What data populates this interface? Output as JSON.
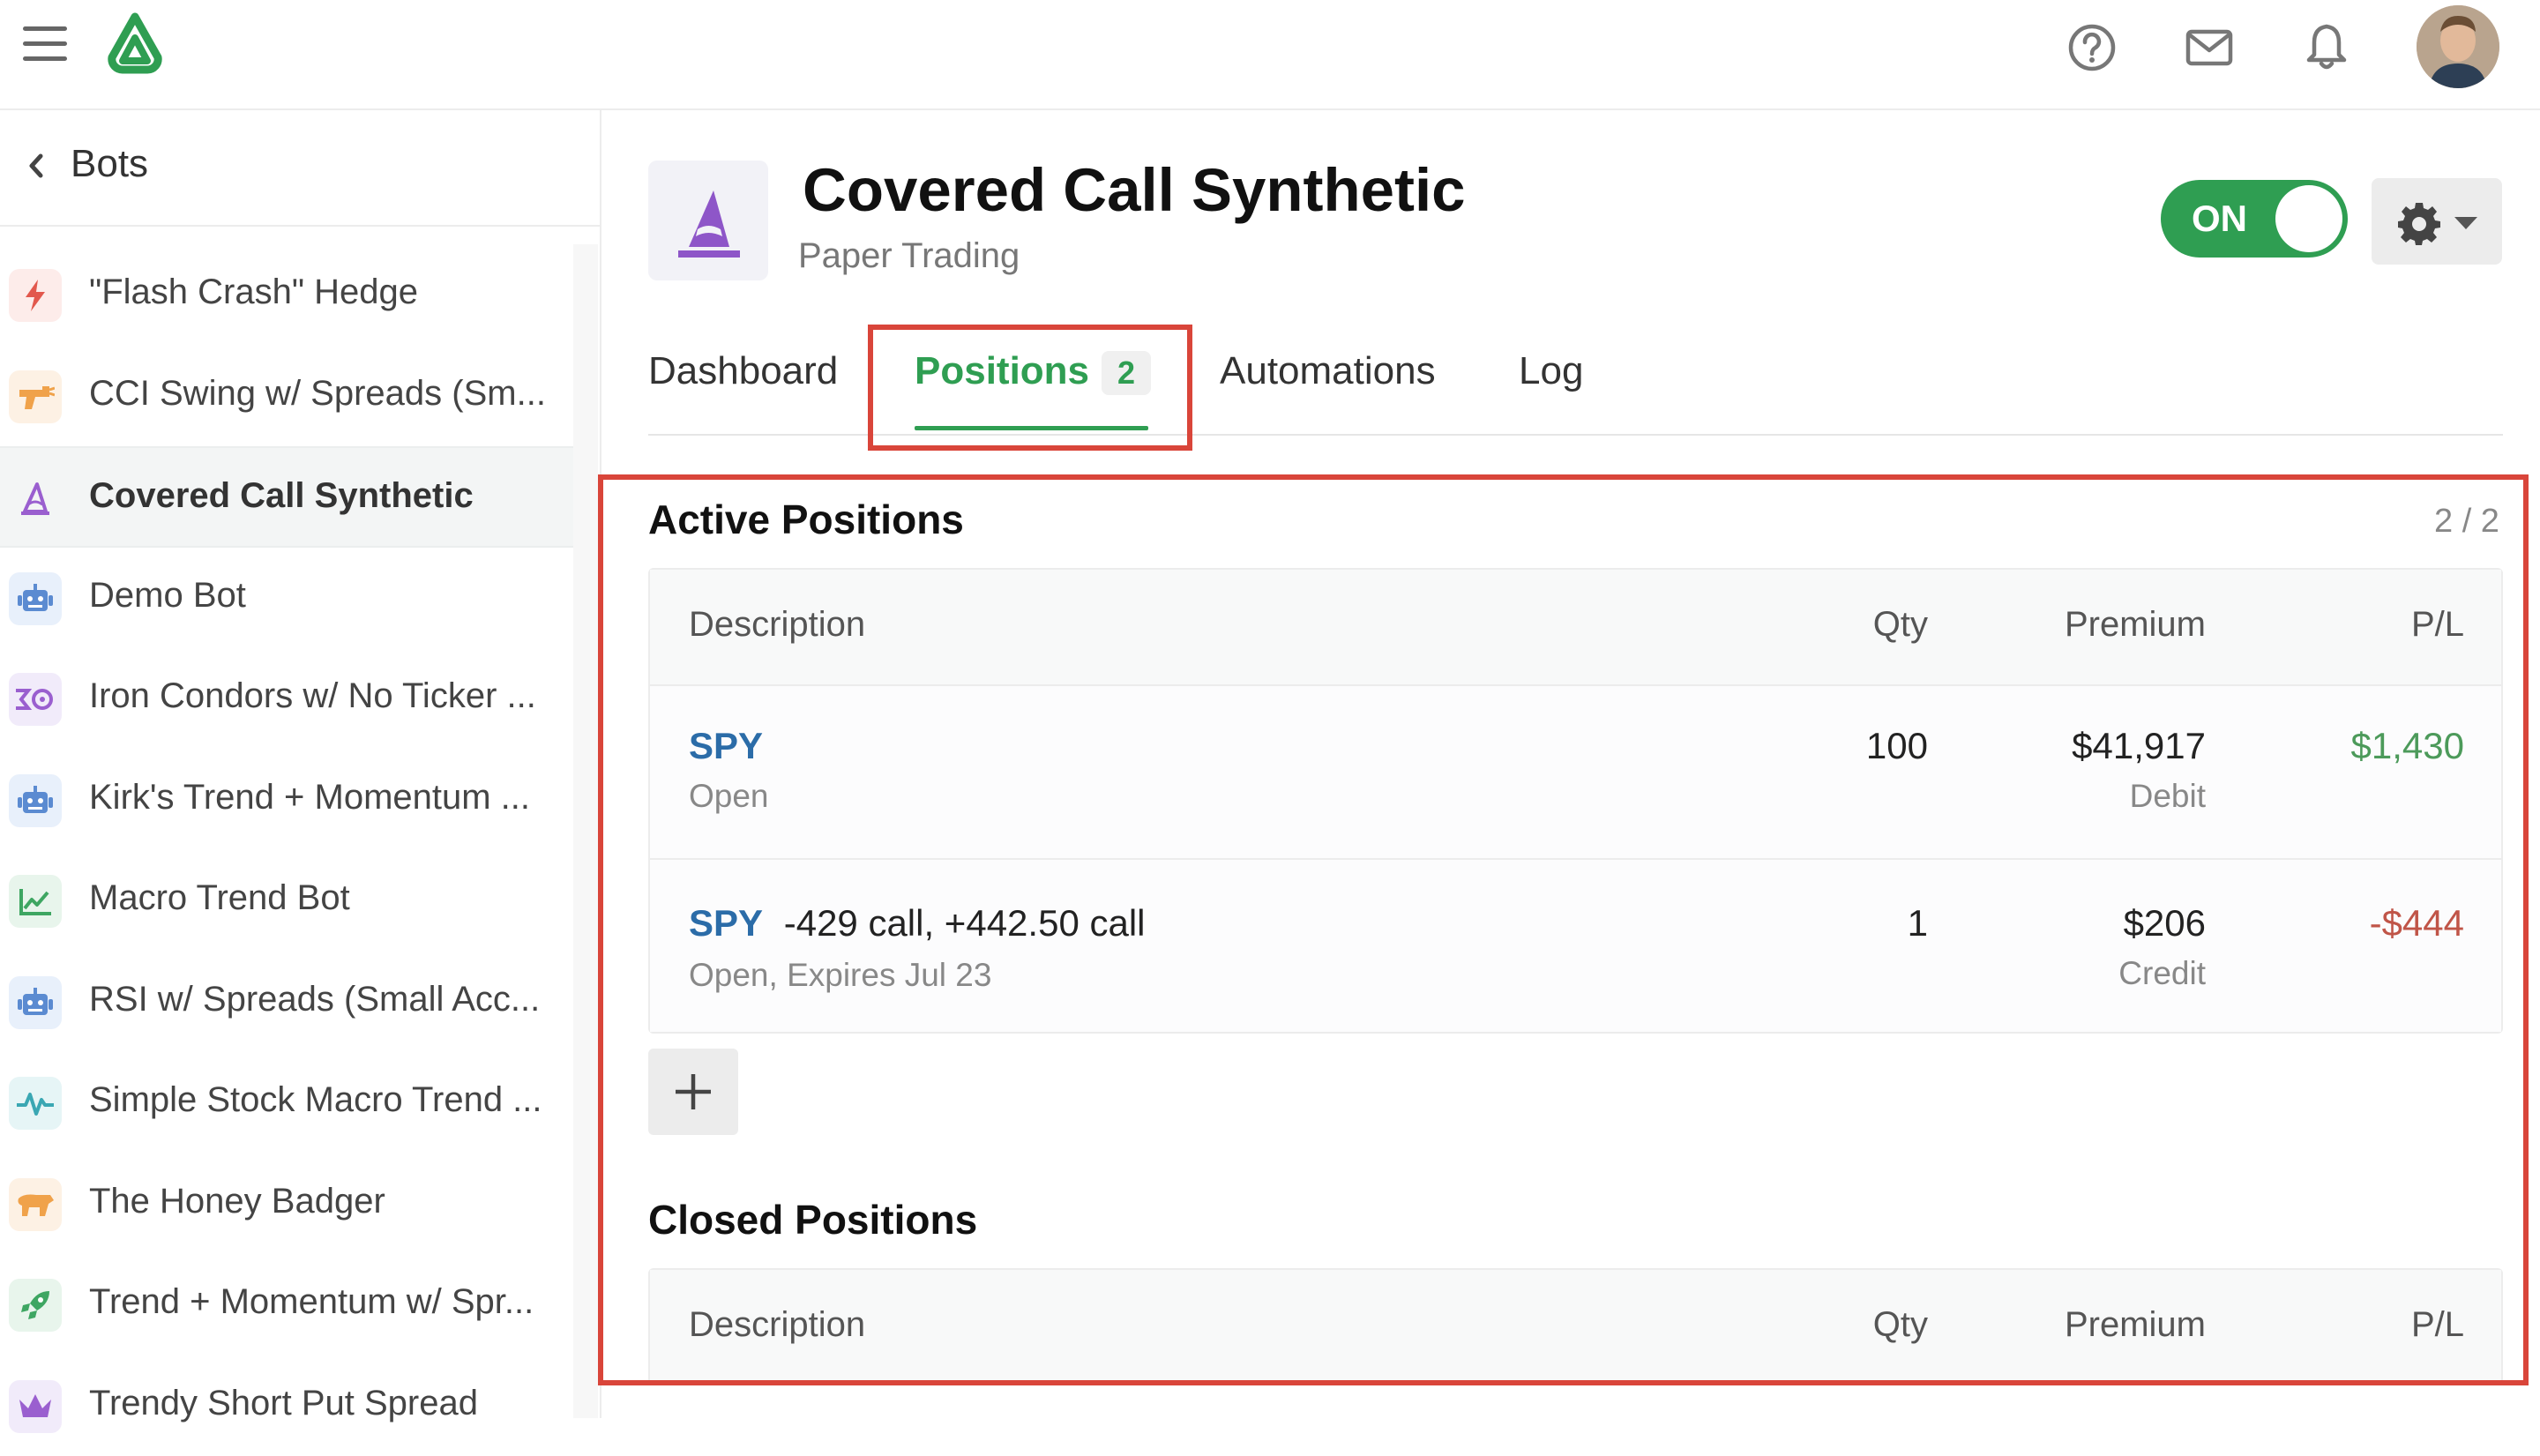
{
  "header": {
    "icons": [
      "menu-icon",
      "help-icon",
      "mail-icon",
      "bell-icon"
    ],
    "brand_color": "#2f9e52"
  },
  "sidebar": {
    "back_label": "Bots",
    "items": [
      {
        "label": "\"Flash Crash\" Hedge",
        "icon": "lightning-icon",
        "active": false
      },
      {
        "label": "CCI Swing w/ Spreads (Sm...",
        "icon": "raygun-icon",
        "active": false
      },
      {
        "label": "Covered Call Synthetic",
        "icon": "wizard-hat-icon",
        "active": true
      },
      {
        "label": "Demo Bot",
        "icon": "robot-icon",
        "active": false
      },
      {
        "label": "Iron Condors w/ No Ticker ...",
        "icon": "condor-icon",
        "active": false
      },
      {
        "label": "Kirk's Trend + Momentum ...",
        "icon": "robot-icon",
        "active": false
      },
      {
        "label": "Macro Trend Bot",
        "icon": "line-chart-icon",
        "active": false
      },
      {
        "label": "RSI w/ Spreads (Small Acc...",
        "icon": "robot-icon",
        "active": false
      },
      {
        "label": "Simple Stock Macro Trend ...",
        "icon": "pulse-icon",
        "active": false
      },
      {
        "label": "The Honey Badger",
        "icon": "badger-icon",
        "active": false
      },
      {
        "label": "Trend + Momentum w/ Spr...",
        "icon": "rocket-icon",
        "active": false
      },
      {
        "label": "Trendy Short Put Spread",
        "icon": "crown-icon",
        "active": false
      }
    ]
  },
  "bot": {
    "title": "Covered Call Synthetic",
    "subtitle": "Paper Trading",
    "toggle_label": "ON",
    "toggle_on": true
  },
  "tabs": [
    {
      "label": "Dashboard"
    },
    {
      "label": "Positions",
      "badge": "2",
      "active": true
    },
    {
      "label": "Automations"
    },
    {
      "label": "Log"
    }
  ],
  "active_positions": {
    "title": "Active Positions",
    "count": "2 / 2",
    "columns": {
      "description": "Description",
      "qty": "Qty",
      "premium": "Premium",
      "pl": "P/L"
    },
    "rows": [
      {
        "symbol": "SPY",
        "detail": "",
        "status": "Open",
        "qty": "100",
        "premium": "$41,917",
        "premium_type": "Debit",
        "pl": "$1,430"
      },
      {
        "symbol": "SPY",
        "detail": "-429 call, +442.50 call",
        "status": "Open, Expires Jul 23",
        "qty": "1",
        "premium": "$206",
        "premium_type": "Credit",
        "pl": "-$444"
      }
    ]
  },
  "closed_positions": {
    "title": "Closed Positions",
    "columns": {
      "description": "Description",
      "qty": "Qty",
      "premium": "Premium",
      "pl": "P/L"
    }
  }
}
